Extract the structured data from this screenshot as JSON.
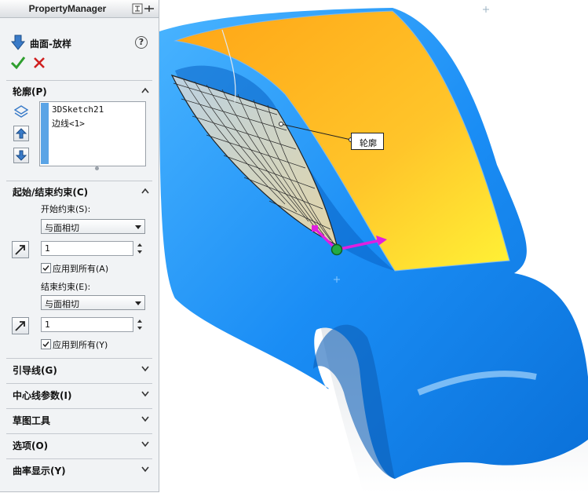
{
  "property_manager": {
    "title": "PropertyManager",
    "feature_name": "曲面-放样",
    "help_symbol": "?"
  },
  "groups": {
    "profile": {
      "title": "轮廓(P)",
      "items": [
        "3DSketch21",
        "边线<1>"
      ]
    },
    "start_end": {
      "title": "起始/结束约束(C)",
      "start_label": "开始约束(S):",
      "start_value": "与面相切",
      "start_number": "1",
      "start_apply_all": "应用到所有(A)",
      "end_label": "结束约束(E):",
      "end_value": "与面相切",
      "end_number": "1",
      "end_apply_all": "应用到所有(Y)"
    },
    "collapsed": [
      "引导线(G)",
      "中心线参数(I)",
      "草图工具",
      "选项(O)",
      "曲率显示(Y)"
    ]
  },
  "viewport": {
    "callout_label": "轮廓",
    "colors": {
      "body_blue": "#1e90ff",
      "roof_yellow": "#ffb81c",
      "handle_magenta": "#e020e0",
      "handle_green": "#22aa44"
    }
  }
}
